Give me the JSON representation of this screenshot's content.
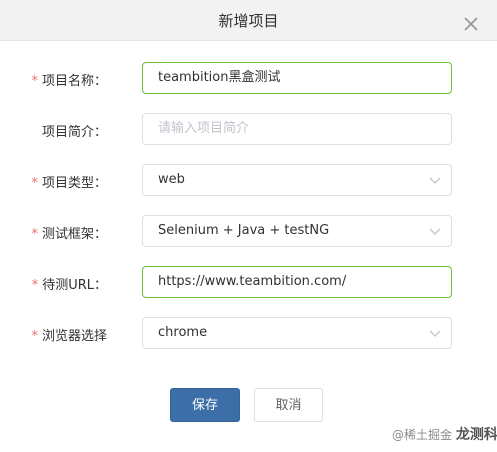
{
  "dialog": {
    "title": "新增项目"
  },
  "form": {
    "fields": [
      {
        "label": "项目名称：",
        "required": true,
        "type": "input",
        "value": "teambition黑盒测试",
        "placeholder": ""
      },
      {
        "label": "项目简介：",
        "required": false,
        "type": "input",
        "value": "",
        "placeholder": "请输入项目简介"
      },
      {
        "label": "项目类型：",
        "required": true,
        "type": "select",
        "value": "web"
      },
      {
        "label": "测试框架：",
        "required": true,
        "type": "select",
        "value": "Selenium + Java + testNG"
      },
      {
        "label": "待测URL：",
        "required": true,
        "type": "input",
        "value": "https://www.teambition.com/",
        "placeholder": ""
      },
      {
        "label": "浏览器选择",
        "required": true,
        "type": "select",
        "value": "chrome"
      }
    ],
    "required_mark": "*"
  },
  "footer": {
    "save_label": "保存",
    "cancel_label": "取消"
  },
  "watermark": {
    "prefix": "@稀土掘金",
    "brand": "龙测科技"
  },
  "colors": {
    "primary": "#3c6ea8",
    "focus_border": "#67c23a",
    "required": "#f56c6c",
    "header_bg": "#f2f2f2"
  }
}
